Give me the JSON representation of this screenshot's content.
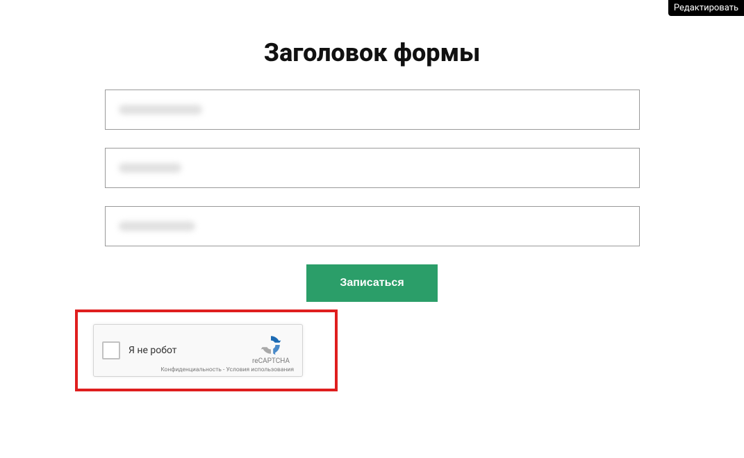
{
  "edit": {
    "label": "Редактировать"
  },
  "form": {
    "title": "Заголовок формы",
    "fields": [
      {
        "value": "",
        "placeholder": ""
      },
      {
        "value": "",
        "placeholder": ""
      },
      {
        "value": "",
        "placeholder": ""
      }
    ],
    "submit_label": "Записаться"
  },
  "captcha": {
    "label": "Я не робот",
    "brand": "reCAPTCHA",
    "privacy": "Конфиденциальность",
    "separator": " - ",
    "terms": "Условия использования"
  }
}
